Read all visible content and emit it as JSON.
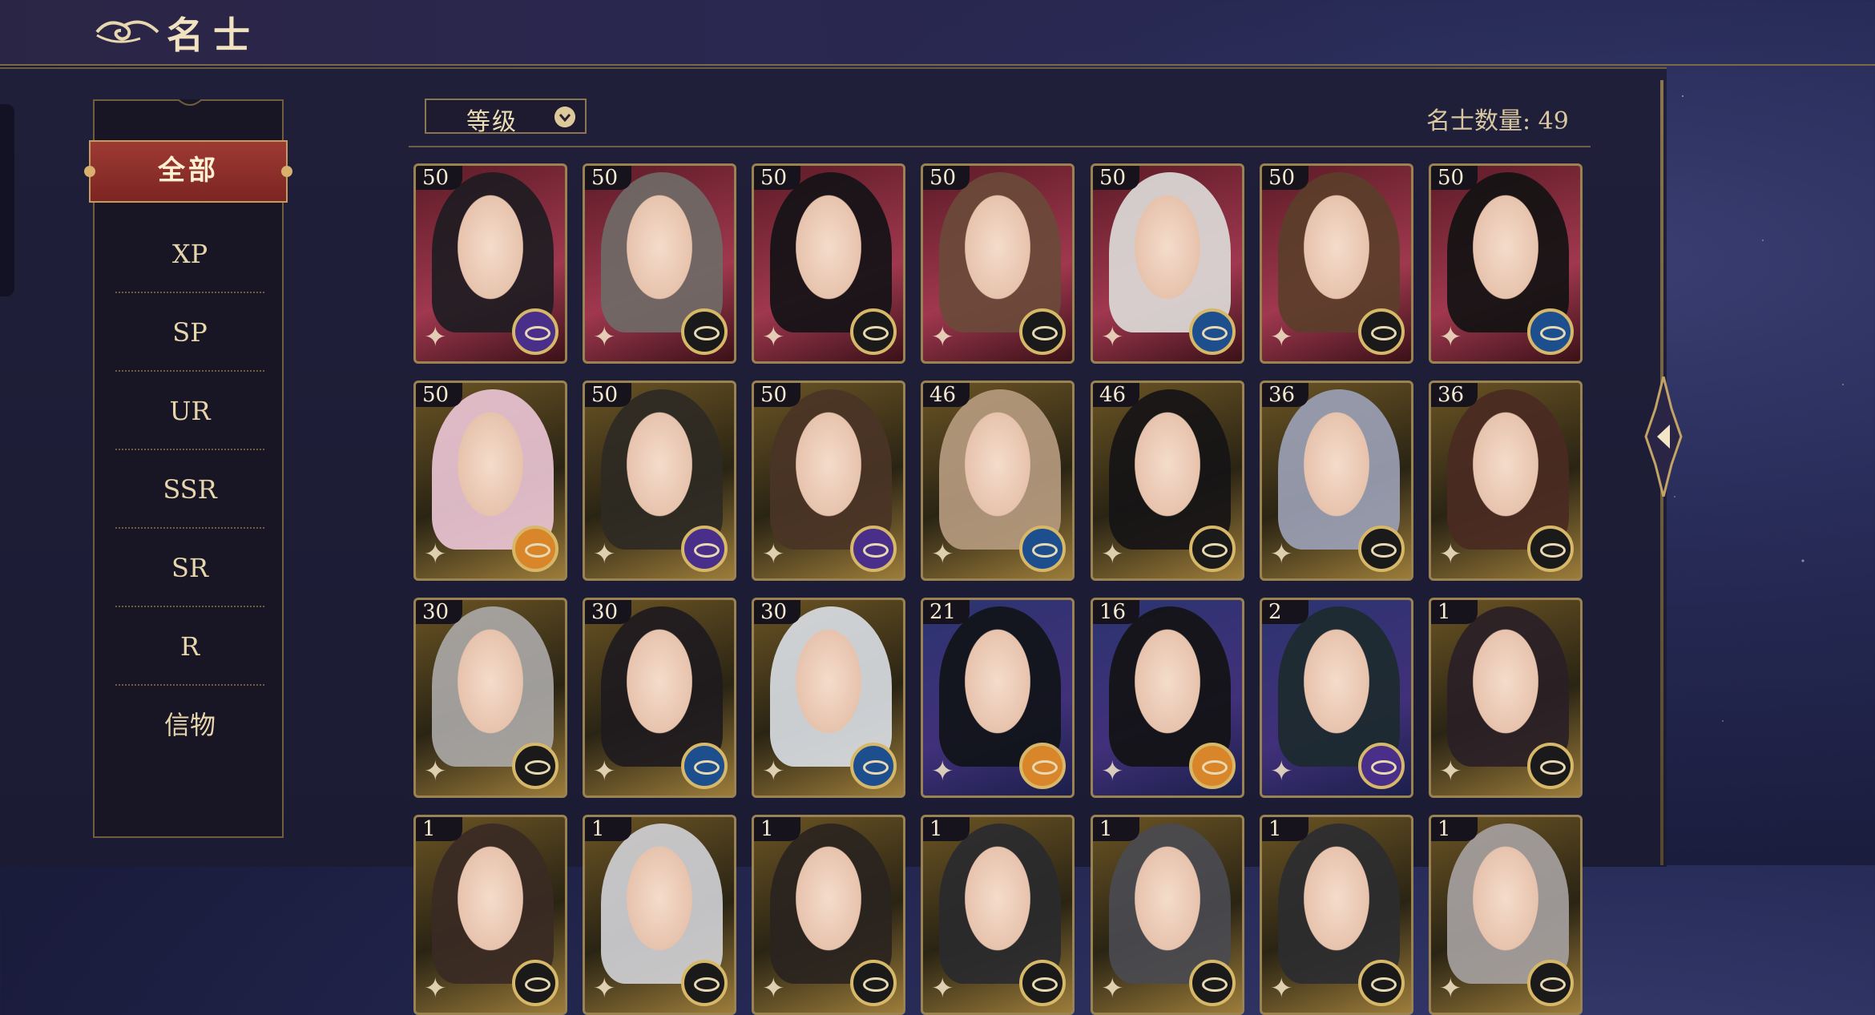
{
  "header": {
    "title": "名士"
  },
  "categories": {
    "active": "全部",
    "items": [
      "XP",
      "SP",
      "UR",
      "SSR",
      "SR",
      "R",
      "信物"
    ]
  },
  "sort": {
    "label": "等级"
  },
  "count": {
    "label": "名士数量: 49"
  },
  "cards": [
    {
      "level": "50",
      "frame": "red",
      "hair": "#1e1c22",
      "badge": "purple"
    },
    {
      "level": "50",
      "frame": "red",
      "hair": "#6f6a66",
      "badge": "dark"
    },
    {
      "level": "50",
      "frame": "red",
      "hair": "#141216",
      "badge": "dark"
    },
    {
      "level": "50",
      "frame": "red",
      "hair": "#6a4a3a",
      "badge": "dark"
    },
    {
      "level": "50",
      "frame": "red",
      "hair": "#dcdad8",
      "badge": "blue"
    },
    {
      "level": "50",
      "frame": "red",
      "hair": "#5b3e2a",
      "badge": "dark"
    },
    {
      "level": "50",
      "frame": "red",
      "hair": "#121212",
      "badge": "blue"
    },
    {
      "level": "50",
      "frame": "gold",
      "hair": "#e9c4d4",
      "badge": "orange"
    },
    {
      "level": "50",
      "frame": "gold",
      "hair": "#2e2a24",
      "badge": "purple"
    },
    {
      "level": "50",
      "frame": "gold",
      "hair": "#4a3426",
      "badge": "purple"
    },
    {
      "level": "46",
      "frame": "gold",
      "hair": "#b59a7e",
      "badge": "blue"
    },
    {
      "level": "46",
      "frame": "gold",
      "hair": "#161416",
      "badge": "dark"
    },
    {
      "level": "36",
      "frame": "gold",
      "hair": "#9aa0b4",
      "badge": "dark"
    },
    {
      "level": "36",
      "frame": "gold",
      "hair": "#4a2a22",
      "badge": "dark"
    },
    {
      "level": "30",
      "frame": "gold",
      "hair": "#a9a7a6",
      "badge": "dark"
    },
    {
      "level": "30",
      "frame": "gold",
      "hair": "#1e1a1e",
      "badge": "blue"
    },
    {
      "level": "30",
      "frame": "gold",
      "hair": "#d8dce2",
      "badge": "blue"
    },
    {
      "level": "21",
      "frame": "blue",
      "hair": "#101418",
      "badge": "orange"
    },
    {
      "level": "16",
      "frame": "blue",
      "hair": "#121214",
      "badge": "orange"
    },
    {
      "level": "2",
      "frame": "blue",
      "hair": "#1c2a2e",
      "badge": "purple"
    },
    {
      "level": "1",
      "frame": "gold",
      "hair": "#2a2026",
      "badge": "dark"
    },
    {
      "level": "1",
      "frame": "gold",
      "hair": "#3a2a24",
      "badge": "dark"
    },
    {
      "level": "1",
      "frame": "gold",
      "hair": "#cfcfd4",
      "badge": "dark"
    },
    {
      "level": "1",
      "frame": "gold",
      "hair": "#2a2420",
      "badge": "dark"
    },
    {
      "level": "1",
      "frame": "gold",
      "hair": "#2a2a2e",
      "badge": "dark"
    },
    {
      "level": "1",
      "frame": "gold",
      "hair": "#4a4a50",
      "badge": "dark"
    },
    {
      "level": "1",
      "frame": "gold",
      "hair": "#2c2c30",
      "badge": "dark"
    },
    {
      "level": "1",
      "frame": "gold",
      "hair": "#a5a0a0",
      "badge": "dark"
    }
  ],
  "colors": {
    "accent_red": "#9e3a34",
    "gold_border": "#9a8350",
    "background": "#1b1d3e"
  }
}
